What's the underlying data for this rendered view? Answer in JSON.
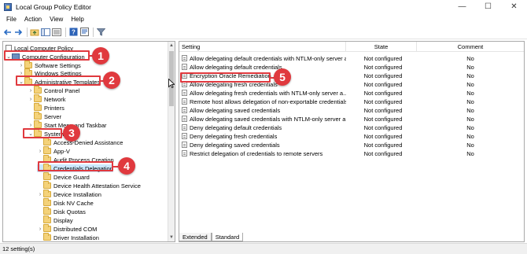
{
  "window": {
    "title": "Local Group Policy Editor",
    "buttons": {
      "minimize": "—",
      "maximize": "☐",
      "close": "✕"
    }
  },
  "menu": [
    "File",
    "Action",
    "View",
    "Help"
  ],
  "toolbar": {
    "icons": [
      "back-icon",
      "forward-icon",
      "folder-up-icon",
      "show-hide-tree-icon",
      "export-list-icon",
      "help-icon",
      "properties-icon",
      "filter-icon"
    ]
  },
  "tree": {
    "items": [
      {
        "label": "Local Computer Policy",
        "expander": "",
        "icon": "policy-doc"
      },
      {
        "label": "Computer Configuration",
        "expander": "⌄",
        "icon": "pc"
      },
      {
        "label": "Software Settings",
        "expander": "›",
        "icon": "folder"
      },
      {
        "label": "Windows Settings",
        "expander": "›",
        "icon": "folder"
      },
      {
        "label": "Administrative Templates",
        "expander": "⌄",
        "icon": "folder"
      },
      {
        "label": "Control Panel",
        "expander": "›",
        "icon": "folder"
      },
      {
        "label": "Network",
        "expander": "›",
        "icon": "folder"
      },
      {
        "label": "Printers",
        "expander": "",
        "icon": "folder"
      },
      {
        "label": "Server",
        "expander": "",
        "icon": "folder"
      },
      {
        "label": "Start Menu and Taskbar",
        "expander": "›",
        "icon": "folder"
      },
      {
        "label": "System",
        "expander": "⌄",
        "icon": "folder"
      },
      {
        "label": "Access-Denied Assistance",
        "expander": "",
        "icon": "folder"
      },
      {
        "label": "App-V",
        "expander": "›",
        "icon": "folder"
      },
      {
        "label": "Audit Process Creation",
        "expander": "",
        "icon": "folder"
      },
      {
        "label": "Credentials Delegation",
        "expander": "",
        "icon": "folder"
      },
      {
        "label": "Device Guard",
        "expander": "",
        "icon": "folder"
      },
      {
        "label": "Device Health Attestation Service",
        "expander": "",
        "icon": "folder"
      },
      {
        "label": "Device Installation",
        "expander": "›",
        "icon": "folder"
      },
      {
        "label": "Disk NV Cache",
        "expander": "",
        "icon": "folder"
      },
      {
        "label": "Disk Quotas",
        "expander": "",
        "icon": "folder"
      },
      {
        "label": "Display",
        "expander": "",
        "icon": "folder"
      },
      {
        "label": "Distributed COM",
        "expander": "›",
        "icon": "folder"
      },
      {
        "label": "Driver Installation",
        "expander": "",
        "icon": "folder"
      }
    ]
  },
  "list": {
    "headers": {
      "setting": "Setting",
      "state": "State",
      "comment": "Comment"
    },
    "rows": [
      {
        "setting": "Allow delegating default credentials with NTLM-only server a...",
        "state": "Not configured",
        "comment": "No"
      },
      {
        "setting": "Allow delegating default credentials",
        "state": "Not configured",
        "comment": "No"
      },
      {
        "setting": "Encryption Oracle Remediation",
        "state": "Not configured",
        "comment": "No"
      },
      {
        "setting": "Allow delegating fresh credentials",
        "state": "Not configured",
        "comment": "No"
      },
      {
        "setting": "Allow delegating fresh credentials with NTLM-only server a...",
        "state": "Not configured",
        "comment": "No"
      },
      {
        "setting": "Remote host allows delegation of non-exportable credentials",
        "state": "Not configured",
        "comment": "No"
      },
      {
        "setting": "Allow delegating saved credentials",
        "state": "Not configured",
        "comment": "No"
      },
      {
        "setting": "Allow delegating saved credentials with NTLM-only server a...",
        "state": "Not configured",
        "comment": "No"
      },
      {
        "setting": "Deny delegating default credentials",
        "state": "Not configured",
        "comment": "No"
      },
      {
        "setting": "Deny delegating fresh credentials",
        "state": "Not configured",
        "comment": "No"
      },
      {
        "setting": "Deny delegating saved credentials",
        "state": "Not configured",
        "comment": "No"
      },
      {
        "setting": "Restrict delegation of credentials to remote servers",
        "state": "Not configured",
        "comment": "No"
      }
    ]
  },
  "tabs": [
    "Extended",
    "Standard"
  ],
  "status": "12 setting(s)",
  "annotations": {
    "color": "#e0393e",
    "badges": [
      "1",
      "2",
      "3",
      "4",
      "5"
    ]
  }
}
